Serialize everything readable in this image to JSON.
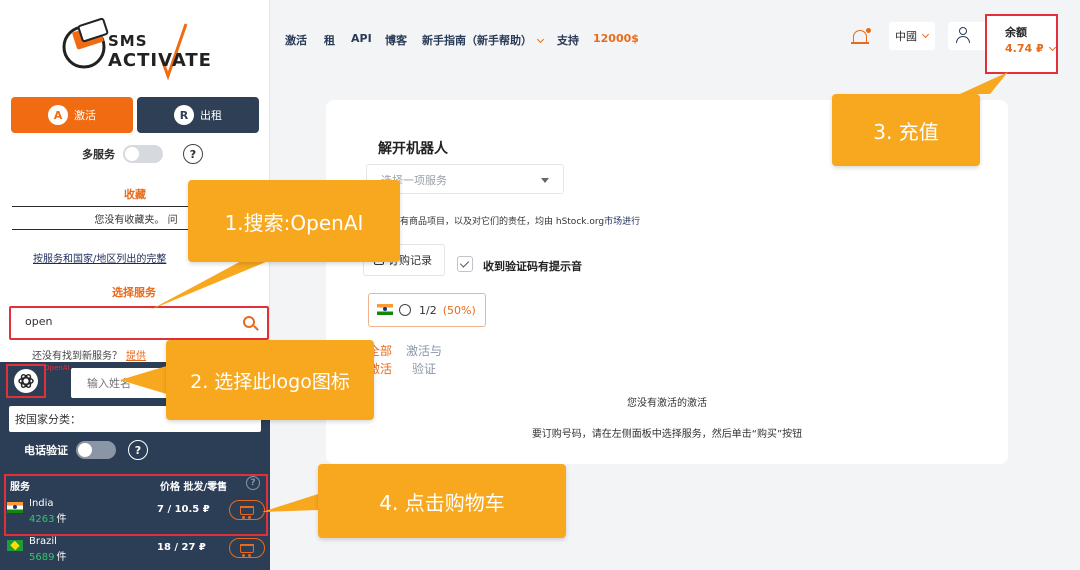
{
  "logo": {
    "line1": "SMS",
    "line2": "ACTIVATE"
  },
  "sidebar": {
    "activate_label": "激活",
    "rent_label": "出租",
    "multi_service_label": "多服务",
    "help_glyph": "?",
    "favorites_title": "收藏",
    "favorites_empty": "您没有收藏夹。 问",
    "list_link": "按服务和国家/地区列出的完整",
    "choose_service_title": "选择服务",
    "search_value": "open",
    "not_found_text": "还没有找到新服务？",
    "not_found_link": "提供",
    "service_vertical_text": "OpenAI",
    "name_placeholder": "输入姓名",
    "country_sort_label": "按国家分类：",
    "phone_verify_label": "电话验证",
    "table": {
      "col_service": "服务",
      "col_price": "价格 批发/零售",
      "rows": [
        {
          "country": "India",
          "count": "4263",
          "unit": "件",
          "price": "7 / 10.5 ₽"
        },
        {
          "country": "Brazil",
          "count": "5689",
          "unit": "件",
          "price": "18 / 27 ₽"
        }
      ]
    }
  },
  "topnav": {
    "items": [
      "激活",
      "租",
      "API",
      "博客",
      "新手指南（新手帮助）",
      "支持",
      "12000$"
    ],
    "language": "中國",
    "balance_label": "余额",
    "balance_value": "4.74 ₽"
  },
  "main": {
    "title": "解开机器人",
    "select_placeholder": "选择一项服务",
    "note_text": "户的所有商品项目，以及对它们的责任，均由 hStock.org",
    "note_link": "市场进行",
    "orders_label": "订购记录",
    "sound_label": "收到验证码有提示音",
    "chip_count": "1/2",
    "chip_pct": "(50%)",
    "tab_all": "全部激活",
    "tab_activate": "激活与验证",
    "empty_title": "您没有激活的激活",
    "empty_desc": "要订购号码，请在左侧面板中选择服务，然后单击“购买”按钮"
  },
  "callouts": {
    "step1": "1.搜索:OpenAI",
    "step2": "2. 选择此logo图标",
    "step3": "3. 充值",
    "step4": "4. 点击购物车"
  },
  "colors": {
    "accent": "#f06b12",
    "dark": "#2c3e56",
    "callout": "#f7a81f",
    "highlight": "#e0313a"
  }
}
